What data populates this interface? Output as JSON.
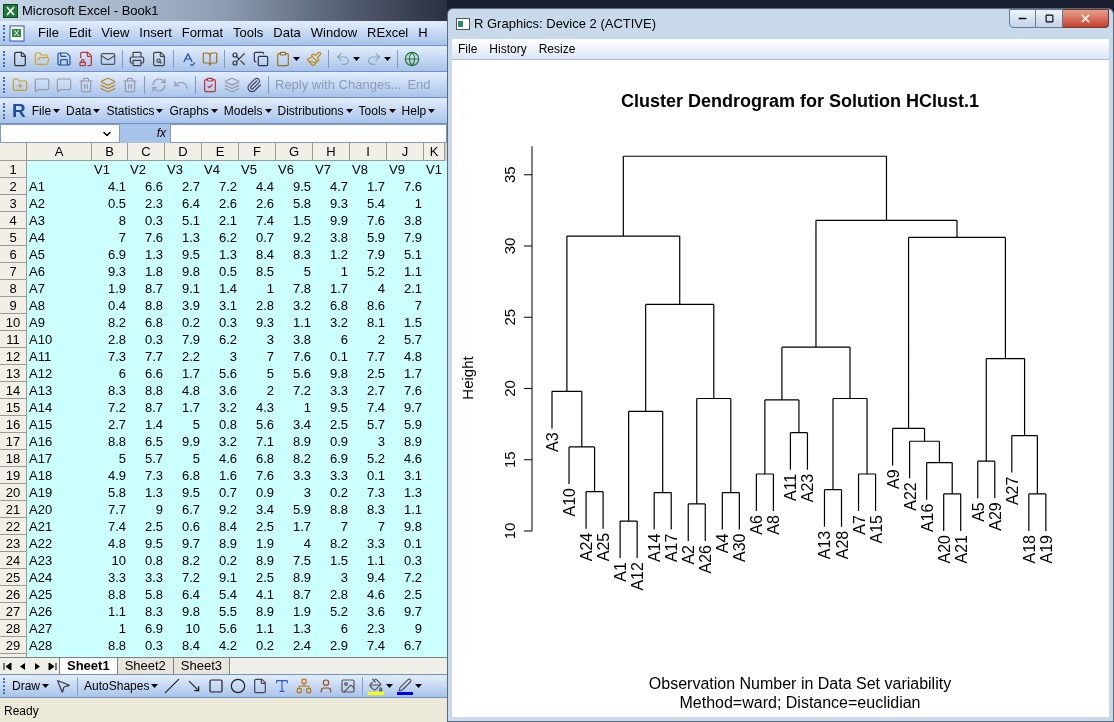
{
  "excel": {
    "title": "Microsoft Excel - Book1",
    "menu": [
      "File",
      "Edit",
      "View",
      "Insert",
      "Format",
      "Tools",
      "Data",
      "Window",
      "RExcel",
      "H"
    ],
    "reviewing_toolbar": {
      "reply_button": {
        "label": "Reply with Changes...",
        "disabled": true
      },
      "end_button": {
        "label": "End",
        "disabled": true
      }
    },
    "r_toolbar": {
      "logo": "R",
      "menus": [
        "File",
        "Data",
        "Statistics",
        "Graphs",
        "Models",
        "Distributions",
        "Tools",
        "Help"
      ]
    },
    "formula_bar": {
      "fx": "fx"
    },
    "columns": [
      "A",
      "B",
      "C",
      "D",
      "E",
      "F",
      "G",
      "H",
      "I",
      "J",
      "K"
    ],
    "rows": [
      {
        "number": "1",
        "cells": [
          "",
          "V1",
          "V2",
          "V3",
          "V4",
          "V5",
          "V6",
          "V7",
          "V8",
          "V9",
          "V1"
        ]
      },
      {
        "number": "2",
        "cells": [
          "A1",
          "4.1",
          "6.6",
          "2.7",
          "7.2",
          "4.4",
          "9.5",
          "4.7",
          "1.7",
          "7.6"
        ]
      },
      {
        "number": "3",
        "cells": [
          "A2",
          "0.5",
          "2.3",
          "6.4",
          "2.6",
          "2.6",
          "5.8",
          "9.3",
          "5.4",
          "1"
        ]
      },
      {
        "number": "4",
        "cells": [
          "A3",
          "8",
          "0.3",
          "5.1",
          "2.1",
          "7.4",
          "1.5",
          "9.9",
          "7.6",
          "3.8"
        ]
      },
      {
        "number": "5",
        "cells": [
          "A4",
          "7",
          "7.6",
          "1.3",
          "6.2",
          "0.7",
          "9.2",
          "3.8",
          "5.9",
          "7.9"
        ]
      },
      {
        "number": "6",
        "cells": [
          "A5",
          "6.9",
          "1.3",
          "9.5",
          "1.3",
          "8.4",
          "8.3",
          "1.2",
          "7.9",
          "5.1"
        ]
      },
      {
        "number": "7",
        "cells": [
          "A6",
          "9.3",
          "1.8",
          "9.8",
          "0.5",
          "8.5",
          "5",
          "1",
          "5.2",
          "1.1"
        ]
      },
      {
        "number": "8",
        "cells": [
          "A7",
          "1.9",
          "8.7",
          "9.1",
          "1.4",
          "1",
          "7.8",
          "1.7",
          "4",
          "2.1"
        ]
      },
      {
        "number": "9",
        "cells": [
          "A8",
          "0.4",
          "8.8",
          "3.9",
          "3.1",
          "2.8",
          "3.2",
          "6.8",
          "8.6",
          "7"
        ]
      },
      {
        "number": "10",
        "cells": [
          "A9",
          "8.2",
          "6.8",
          "0.2",
          "0.3",
          "9.3",
          "1.1",
          "3.2",
          "8.1",
          "1.5"
        ]
      },
      {
        "number": "11",
        "cells": [
          "A10",
          "2.8",
          "0.3",
          "7.9",
          "6.2",
          "3",
          "3.8",
          "6",
          "2",
          "5.7"
        ]
      },
      {
        "number": "12",
        "cells": [
          "A11",
          "7.3",
          "7.7",
          "2.2",
          "3",
          "7",
          "7.6",
          "0.1",
          "7.7",
          "4.8"
        ]
      },
      {
        "number": "13",
        "cells": [
          "A12",
          "6",
          "6.6",
          "1.7",
          "5.6",
          "5",
          "5.6",
          "9.8",
          "2.5",
          "1.7"
        ]
      },
      {
        "number": "14",
        "cells": [
          "A13",
          "8.3",
          "8.8",
          "4.8",
          "3.6",
          "2",
          "7.2",
          "3.3",
          "2.7",
          "7.6"
        ]
      },
      {
        "number": "15",
        "cells": [
          "A14",
          "7.2",
          "8.7",
          "1.7",
          "3.2",
          "4.3",
          "1",
          "9.5",
          "7.4",
          "9.7"
        ]
      },
      {
        "number": "16",
        "cells": [
          "A15",
          "2.7",
          "1.4",
          "5",
          "0.8",
          "5.6",
          "3.4",
          "2.5",
          "5.7",
          "5.9"
        ]
      },
      {
        "number": "17",
        "cells": [
          "A16",
          "8.8",
          "6.5",
          "9.9",
          "3.2",
          "7.1",
          "8.9",
          "0.9",
          "3",
          "8.9"
        ]
      },
      {
        "number": "18",
        "cells": [
          "A17",
          "5",
          "5.7",
          "5",
          "4.6",
          "6.8",
          "8.2",
          "6.9",
          "5.2",
          "4.6"
        ]
      },
      {
        "number": "19",
        "cells": [
          "A18",
          "4.9",
          "7.3",
          "6.8",
          "1.6",
          "7.6",
          "3.3",
          "3.3",
          "0.1",
          "3.1"
        ]
      },
      {
        "number": "20",
        "cells": [
          "A19",
          "5.8",
          "1.3",
          "9.5",
          "0.7",
          "0.9",
          "3",
          "0.2",
          "7.3",
          "1.3"
        ]
      },
      {
        "number": "21",
        "cells": [
          "A20",
          "7.7",
          "9",
          "6.7",
          "9.2",
          "3.4",
          "5.9",
          "8.8",
          "8.3",
          "1.1"
        ]
      },
      {
        "number": "22",
        "cells": [
          "A21",
          "7.4",
          "2.5",
          "0.6",
          "8.4",
          "2.5",
          "1.7",
          "7",
          "7",
          "9.8"
        ]
      },
      {
        "number": "23",
        "cells": [
          "A22",
          "4.8",
          "9.5",
          "9.7",
          "8.9",
          "1.9",
          "4",
          "8.2",
          "3.3",
          "0.1"
        ]
      },
      {
        "number": "24",
        "cells": [
          "A23",
          "10",
          "0.8",
          "8.2",
          "0.2",
          "8.9",
          "7.5",
          "1.5",
          "1.1",
          "0.3"
        ]
      },
      {
        "number": "25",
        "cells": [
          "A24",
          "3.3",
          "3.3",
          "7.2",
          "9.1",
          "2.5",
          "8.9",
          "3",
          "9.4",
          "7.2"
        ]
      },
      {
        "number": "26",
        "cells": [
          "A25",
          "8.8",
          "5.8",
          "6.4",
          "5.4",
          "4.1",
          "8.7",
          "2.8",
          "4.6",
          "2.5"
        ]
      },
      {
        "number": "27",
        "cells": [
          "A26",
          "1.1",
          "8.3",
          "9.8",
          "5.5",
          "8.9",
          "1.9",
          "5.2",
          "3.6",
          "9.7"
        ]
      },
      {
        "number": "28",
        "cells": [
          "A27",
          "1",
          "6.9",
          "10",
          "5.6",
          "1.1",
          "1.3",
          "6",
          "2.3",
          "9"
        ]
      },
      {
        "number": "29",
        "cells": [
          "A28",
          "8.8",
          "0.3",
          "8.4",
          "4.2",
          "0.2",
          "2.4",
          "2.9",
          "7.4",
          "6.7"
        ]
      }
    ],
    "sheet_tabs": [
      {
        "label": "Sheet1",
        "selected": true
      },
      {
        "label": "Sheet2",
        "selected": false
      },
      {
        "label": "Sheet3",
        "selected": false
      }
    ],
    "drawing_toolbar": {
      "draw": "Draw",
      "autoshapes": "AutoShapes"
    },
    "status_bar": "Ready"
  },
  "r_window": {
    "title": "R Graphics: Device 2 (ACTIVE)",
    "menu": [
      "File",
      "History",
      "Resize"
    ],
    "plot": {
      "title": "Cluster Dendrogram for Solution HClust.1",
      "ylabel": "Height",
      "yticks": [
        "10",
        "15",
        "20",
        "25",
        "30",
        "35"
      ],
      "leaves": [
        "A3",
        "A10",
        "A24",
        "A25",
        "A1",
        "A12",
        "A14",
        "A17",
        "A2",
        "A26",
        "A4",
        "A30",
        "A6",
        "A8",
        "A11",
        "A23",
        "A13",
        "A28",
        "A7",
        "A15",
        "A9",
        "A22",
        "A16",
        "A20",
        "A21",
        "A5",
        "A29",
        "A27",
        "A18",
        "A19"
      ],
      "caption": [
        "Observation Number in Data Set variability",
        "Method=ward; Distance=euclidian"
      ]
    }
  }
}
